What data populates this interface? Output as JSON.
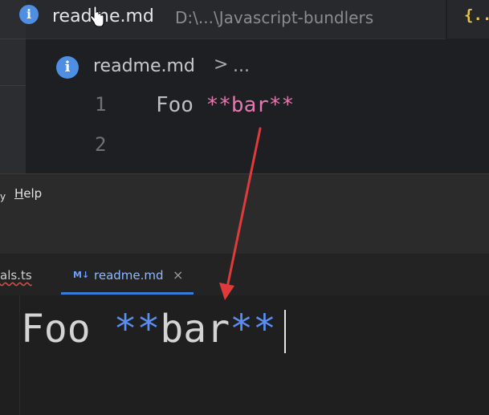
{
  "top_editor": {
    "tab": {
      "icon": "info-icon",
      "icon_glyph": "i",
      "title": "readme.md",
      "path": "D:\\...\\Javascript-bundlers",
      "right_icon": "json-braces-icon",
      "right_icon_glyph": "{..}"
    },
    "breadcrumb": {
      "icon": "info-icon",
      "icon_glyph": "i",
      "file": "readme.md",
      "separator": ">",
      "more": "..."
    },
    "lines": [
      {
        "number": "1",
        "plain": "Foo ",
        "markup": "**bar**"
      },
      {
        "number": "2",
        "plain": "",
        "markup": ""
      }
    ],
    "colors": {
      "text": "#bcbec4",
      "markup": "#e17ab0"
    }
  },
  "menubar": {
    "edge_glyph": "y",
    "help_mnemonic": "H",
    "help_rest": "elp"
  },
  "bottom_editor": {
    "tabs": [
      {
        "label": "als.ts",
        "active": false
      },
      {
        "badge": "M↓",
        "label": "readme.md",
        "active": true,
        "close": "×"
      }
    ],
    "content": {
      "plain": "Foo ",
      "markup_open": "**",
      "word": "bar",
      "markup_close": "**"
    },
    "colors": {
      "text": "#d4d4d4",
      "markup": "#5b8ef0",
      "active_tab": "#3a7bd5"
    }
  },
  "annotation": {
    "color": "#e03a3a"
  }
}
